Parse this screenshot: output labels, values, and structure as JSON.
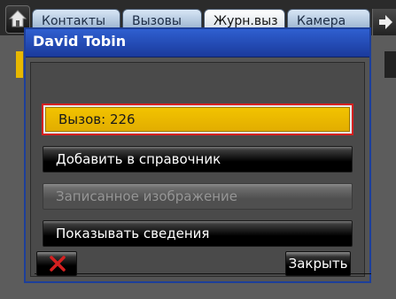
{
  "tabs": [
    {
      "label": "Контакты"
    },
    {
      "label": "Вызовы"
    },
    {
      "label": "Журн.выз"
    },
    {
      "label": "Камера"
    }
  ],
  "dialog": {
    "title": "David Tobin",
    "options": [
      {
        "label": "Вызов: 226",
        "state": "selected"
      },
      {
        "label": "Добавить в справочник",
        "state": "enabled"
      },
      {
        "label": "Записанное изображение",
        "state": "disabled"
      },
      {
        "label": "Показывать сведения",
        "state": "enabled"
      }
    ],
    "close_label": "Закрыть"
  },
  "colors": {
    "titlebar": "#1f47b8",
    "selection_fill": "#e8b800",
    "selection_border": "#d42020",
    "close_x": "#d42020"
  },
  "icons": [
    "home-icon",
    "arrow-right-icon",
    "close-x-icon"
  ]
}
